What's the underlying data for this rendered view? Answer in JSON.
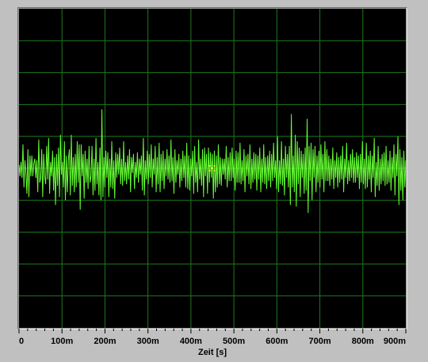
{
  "chart_data": {
    "type": "line",
    "xlabel": "Zeit [s]",
    "ylabel": "",
    "xlim": [
      0,
      0.9
    ],
    "ylim": [
      -10,
      10
    ],
    "x_ticks": [
      "0",
      "100m",
      "200m",
      "300m",
      "400m",
      "500m",
      "600m",
      "700m",
      "800m",
      "900m"
    ],
    "grid": true,
    "y_grid_lines": 10,
    "x_minor_per_major": 5,
    "colors": {
      "plot_bg": "#000000",
      "grid": "#1c7a1c",
      "trace": "#66ff33",
      "cursor": "#ffff33",
      "frame": "#c0c0c0"
    },
    "series": [
      {
        "values": [
          0.2,
          -0.5,
          0.4,
          -0.6,
          1.5,
          -1.2,
          0.5,
          -0.3,
          -1.6,
          1.2,
          -1.8,
          0.8,
          -0.5,
          0.8,
          -0.5,
          0.3,
          0.6,
          -0.6,
          0.5,
          -1.5,
          1.8,
          -0.9,
          -0.6,
          1.2,
          -1.8,
          0.9,
          -0.5,
          -1.0,
          1.4,
          -0.7,
          1.9,
          -1.6,
          0.4,
          -0.5,
          1.1,
          -1.4,
          0.7,
          -2.3,
          0.9,
          -1.1,
          1.3,
          -1.8,
          2.1,
          -0.4,
          0.4,
          -1.2,
          1.7,
          -2.0,
          0.8,
          -1.5,
          0.5,
          1.2,
          -1.7,
          2.1,
          -1.1,
          0.7,
          -1.5,
          0.9,
          -1.2,
          1.7,
          -0.9,
          1.5,
          -2.6,
          1.5,
          -0.5,
          0.9,
          -1.9,
          1.1,
          -0.9,
          0.6,
          -1.3,
          1.4,
          -0.9,
          -0.5,
          1.4,
          -1.7,
          0.6,
          -1.4,
          1.9,
          -1.0,
          0.4,
          -1.7,
          1.3,
          -2.0,
          3.7,
          -1.8,
          0.7,
          -1.2,
          1.1,
          -0.6,
          1.0,
          -1.8,
          0.6,
          -1.2,
          1.7,
          -1.3,
          0.5,
          -1.9,
          1.0,
          -0.6,
          0.9,
          -0.4,
          1.3,
          -1.0,
          0.6,
          -1.1,
          1.7,
          -0.8,
          0.4,
          -1.0,
          0.8,
          -0.7,
          1.2,
          -1.5,
          0.7,
          -0.3,
          0.9,
          -1.3,
          0.4,
          -0.6,
          1.0,
          -0.9,
          0.6,
          -0.4,
          0.8,
          -1.4,
          1.9,
          -1.7,
          0.5,
          -0.7,
          1.1,
          -1.0,
          0.9,
          -0.6,
          1.5,
          -1.2,
          0.6,
          -0.4,
          1.4,
          -1.5,
          0.7,
          -1.0,
          1.6,
          -1.5,
          0.9,
          -0.8,
          1.1,
          -1.3,
          0.6,
          -0.5,
          1.2,
          -0.7,
          0.8,
          -0.9,
          1.8,
          -0.8,
          0.7,
          -1.6,
          1.2,
          -0.9,
          0.5,
          -0.4,
          0.9,
          -1.2,
          0.6,
          -0.8,
          1.1,
          -0.6,
          0.8,
          -1.2,
          1.6,
          -1.3,
          0.8,
          -1.4,
          0.6,
          -0.5,
          1.1,
          -1.6,
          1.4,
          -0.9,
          0.4,
          -1.5,
          1.8,
          -0.7,
          0.6,
          -1.1,
          1.2,
          -1.8,
          1.3,
          -0.5,
          0.9,
          -1.6,
          1.3,
          -0.9,
          1.0,
          -0.6,
          0.9,
          -1.9,
          1.1,
          -1.5,
          0.8,
          -1.2,
          1.5,
          -1.0,
          0.7,
          -1.1,
          0.6,
          -0.4,
          0.6,
          -0.7,
          1.4,
          -1.2,
          0.7,
          -0.8,
          1.0,
          -0.8,
          1.3,
          -0.6,
          0.6,
          -1.4,
          1.1,
          -0.9,
          1.0,
          -0.9,
          1.6,
          -1.0,
          0.5,
          -0.8,
          1.2,
          -1.5,
          0.8,
          -0.5,
          0.9,
          -1.0,
          1.5,
          -1.3,
          0.6,
          -0.9,
          1.0,
          -0.7,
          0.9,
          -1.4,
          0.8,
          -0.7,
          1.3,
          -1.5,
          0.6,
          -0.9,
          1.5,
          -1.0,
          0.7,
          -1.3,
          0.8,
          -0.8,
          1.1,
          -1.2,
          0.9,
          -0.8,
          1.6,
          -0.6,
          0.5,
          -1.3,
          2.0,
          -1.5,
          0.5,
          -1.0,
          1.7,
          -1.1,
          0.6,
          -1.7,
          1.4,
          -0.6,
          0.9,
          -1.2,
          1.4,
          -2.3,
          3.4,
          -1.2,
          0.8,
          -1.5,
          2.1,
          -2.4,
          1.7,
          -1.0,
          1.3,
          -1.8,
          1.1,
          -0.6,
          0.9,
          -1.6,
          1.3,
          -1.4,
          3.1,
          -2.8,
          1.4,
          -0.8,
          1.6,
          -2.0,
          1.2,
          -0.6,
          1.4,
          -1.5,
          0.8,
          -0.9,
          1.1,
          -1.2,
          1.5,
          -0.7,
          0.9,
          -1.5,
          1.7,
          -0.8,
          1.2,
          -0.8,
          0.8,
          -1.1,
          0.6,
          -0.7,
          1.3,
          -1.3,
          0.5,
          -0.6,
          1.0,
          -1.2,
          0.7,
          -0.9,
          0.8,
          -0.7,
          1.4,
          -1.5,
          0.6,
          -0.6,
          1.6,
          -1.0,
          0.5,
          -0.8,
          0.9,
          -0.6,
          1.2,
          -0.9,
          0.7,
          -0.9,
          1.0,
          -0.6,
          0.8,
          -1.3,
          0.9,
          -0.9,
          1.7,
          -1.0,
          0.6,
          -1.3,
          1.6,
          -1.2,
          0.8,
          -0.7,
          1.1,
          -1.5,
          0.8,
          -0.6,
          1.9,
          -1.8,
          0.4,
          -1.1,
          1.4,
          -1.4,
          0.6,
          -1.0,
          0.9,
          -0.8,
          1.0,
          -1.1,
          1.4,
          -1.0,
          0.5,
          -0.9,
          1.1,
          -1.4,
          0.7,
          -0.6,
          1.5,
          -1.7,
          0.9,
          -0.5,
          2.0,
          -2.3,
          1.2,
          -1.4,
          0.7,
          -2.0,
          1.1,
          -1.2,
          0.5
        ]
      }
    ]
  }
}
